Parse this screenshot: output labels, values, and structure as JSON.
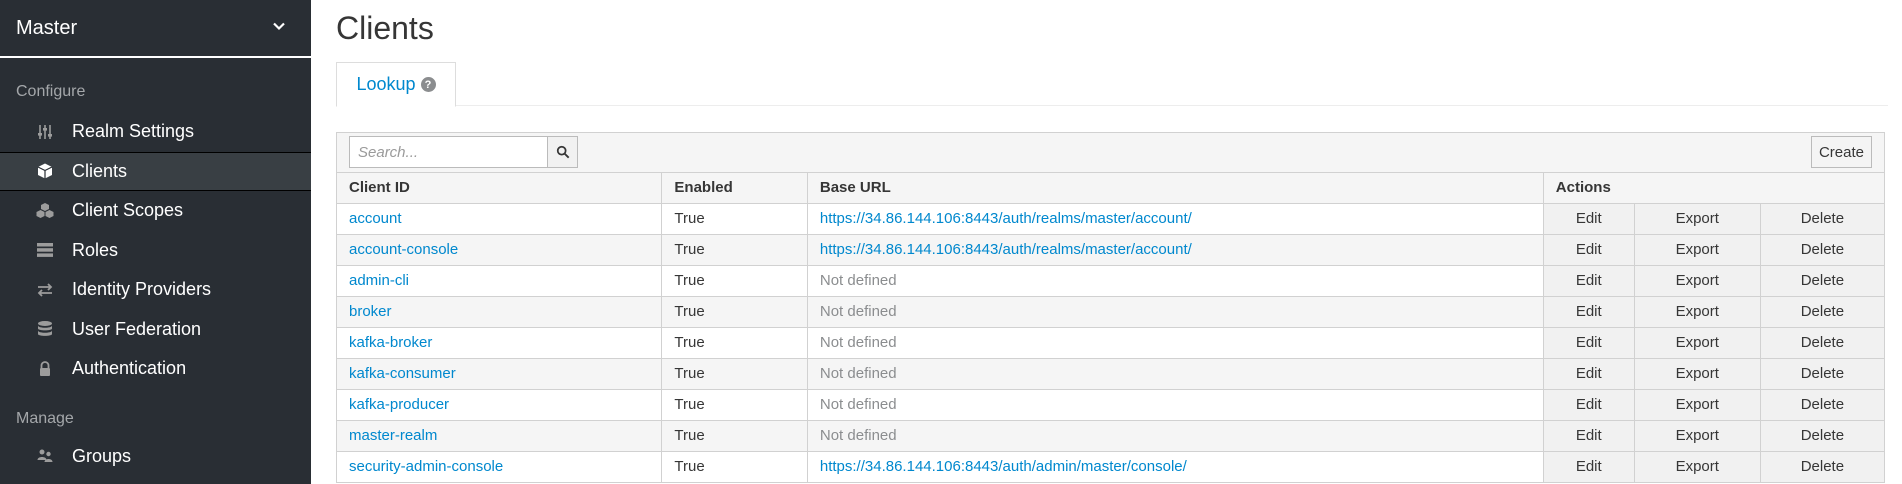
{
  "sidebar": {
    "realm": "Master",
    "configure_label": "Configure",
    "manage_label": "Manage",
    "configure_items": [
      {
        "label": "Realm Settings",
        "icon": "sliders-icon",
        "active": false
      },
      {
        "label": "Clients",
        "icon": "cube-icon",
        "active": true
      },
      {
        "label": "Client Scopes",
        "icon": "cubes-icon",
        "active": false
      },
      {
        "label": "Roles",
        "icon": "list-icon",
        "active": false
      },
      {
        "label": "Identity Providers",
        "icon": "exchange-icon",
        "active": false
      },
      {
        "label": "User Federation",
        "icon": "database-icon",
        "active": false
      },
      {
        "label": "Authentication",
        "icon": "lock-icon",
        "active": false
      }
    ],
    "manage_items": [
      {
        "label": "Groups",
        "icon": "users-icon",
        "active": false
      }
    ]
  },
  "main": {
    "title": "Clients",
    "tab_label": "Lookup",
    "search_placeholder": "Search...",
    "create_label": "Create",
    "columns": [
      "Client ID",
      "Enabled",
      "Base URL",
      "Actions"
    ],
    "action_labels": [
      "Edit",
      "Export",
      "Delete"
    ],
    "rows": [
      {
        "client_id": "account",
        "enabled": "True",
        "base_url": "https://34.86.144.106:8443/auth/realms/master/account/",
        "defined": true
      },
      {
        "client_id": "account-console",
        "enabled": "True",
        "base_url": "https://34.86.144.106:8443/auth/realms/master/account/",
        "defined": true
      },
      {
        "client_id": "admin-cli",
        "enabled": "True",
        "base_url": "Not defined",
        "defined": false
      },
      {
        "client_id": "broker",
        "enabled": "True",
        "base_url": "Not defined",
        "defined": false
      },
      {
        "client_id": "kafka-broker",
        "enabled": "True",
        "base_url": "Not defined",
        "defined": false
      },
      {
        "client_id": "kafka-consumer",
        "enabled": "True",
        "base_url": "Not defined",
        "defined": false
      },
      {
        "client_id": "kafka-producer",
        "enabled": "True",
        "base_url": "Not defined",
        "defined": false
      },
      {
        "client_id": "master-realm",
        "enabled": "True",
        "base_url": "Not defined",
        "defined": false
      },
      {
        "client_id": "security-admin-console",
        "enabled": "True",
        "base_url": "https://34.86.144.106:8443/auth/admin/master/console/",
        "defined": true
      }
    ]
  },
  "colors": {
    "sidebar_bg": "#292e34",
    "sidebar_active": "#393f44",
    "link": "#0088ce",
    "muted": "#8b8d8f"
  }
}
